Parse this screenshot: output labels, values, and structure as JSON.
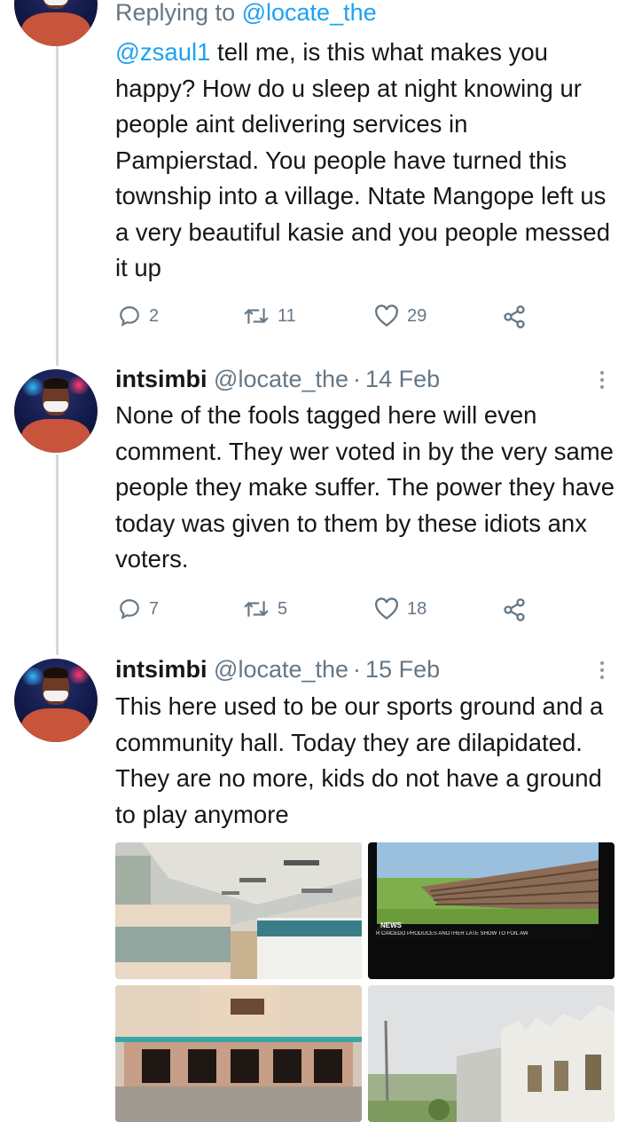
{
  "colors": {
    "accent": "#1da1f2",
    "secondary_text": "#657786",
    "thread_line": "#cfd9de"
  },
  "tweet1": {
    "replying_prefix": "Replying to",
    "replying_handle": "@locate_the",
    "mention": "@zsaul1",
    "text": " tell me, is this what makes you happy? How do u sleep at night knowing ur people aint delivering services in Pampierstad. You people have turned this township into a village. Ntate Mangope left us a very beautiful kasie and you people messed it up",
    "replies": "2",
    "retweets": "11",
    "likes": "29"
  },
  "tweet2": {
    "username": "intsimbi",
    "handle": "@locate_the",
    "sep": "·",
    "date": "14 Feb",
    "text": "None of the fools tagged here will even comment. They wer voted in by the very same people they make suffer. The power they have today was given to them by these idiots anx voters.",
    "replies": "7",
    "retweets": "5",
    "likes": "18"
  },
  "tweet3": {
    "username": "intsimbi",
    "handle": "@locate_the",
    "sep": "·",
    "date": "15 Feb",
    "text": "This here used to be our sports ground and a community hall. Today they are dilapidated. They are no more, kids do not have a ground to play anymore",
    "media": {
      "news_logo": "NEWS",
      "news_ticker": "R CAICEDO PRODUCES ANOTHER LATE SHOW TO FOIL AW"
    }
  },
  "icons": {
    "reply": "reply-icon",
    "retweet": "retweet-icon",
    "like": "heart-icon",
    "share": "share-icon",
    "more": "more-vertical-icon"
  }
}
